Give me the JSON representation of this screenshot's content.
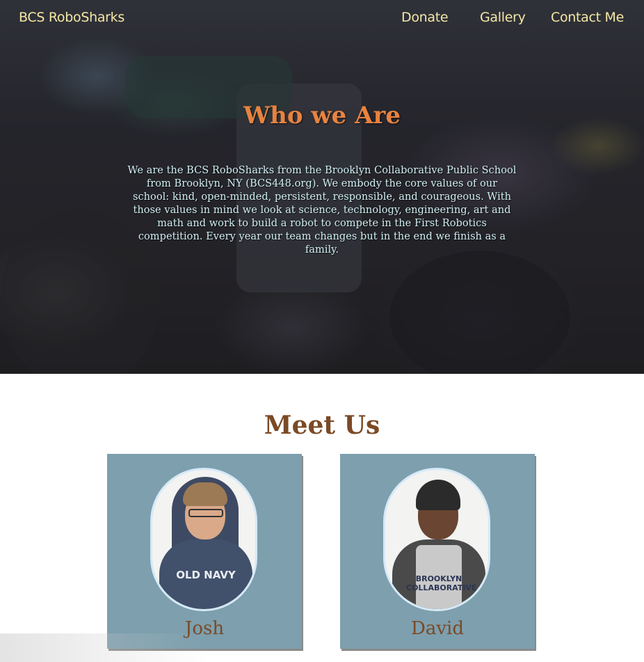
{
  "nav": {
    "brand": "BCS RoboSharks",
    "links": [
      "Donate",
      "Gallery",
      "Contact Me"
    ]
  },
  "hero": {
    "title": "Who we Are",
    "text": "We are the BCS RoboSharks from the Brooklyn Collaborative Public School from Brooklyn, NY (BCS448.org). We embody the core values of our school: kind, open-minded, persistent, responsible, and courageous. With those values in mind we look at science, technology, engineering, art and math and work to build a robot to compete in the First Robotics competition. Every year our team changes but in the end we finish as a family."
  },
  "meet": {
    "title": "Meet Us",
    "members": [
      {
        "name": "Josh",
        "shirt_text": "OLD NAVY"
      },
      {
        "name": "David",
        "shirt_text": "BROOKLYN COLLABORATIVE"
      }
    ]
  },
  "colors": {
    "nav_text": "#f4e7a6",
    "hero_title": "#e88340",
    "hero_text": "#cfeef2",
    "heading_brown": "#7a4a25",
    "card_bg": "#7d9fae"
  },
  "icons": {
    "background": "robotics-competition-photo"
  }
}
